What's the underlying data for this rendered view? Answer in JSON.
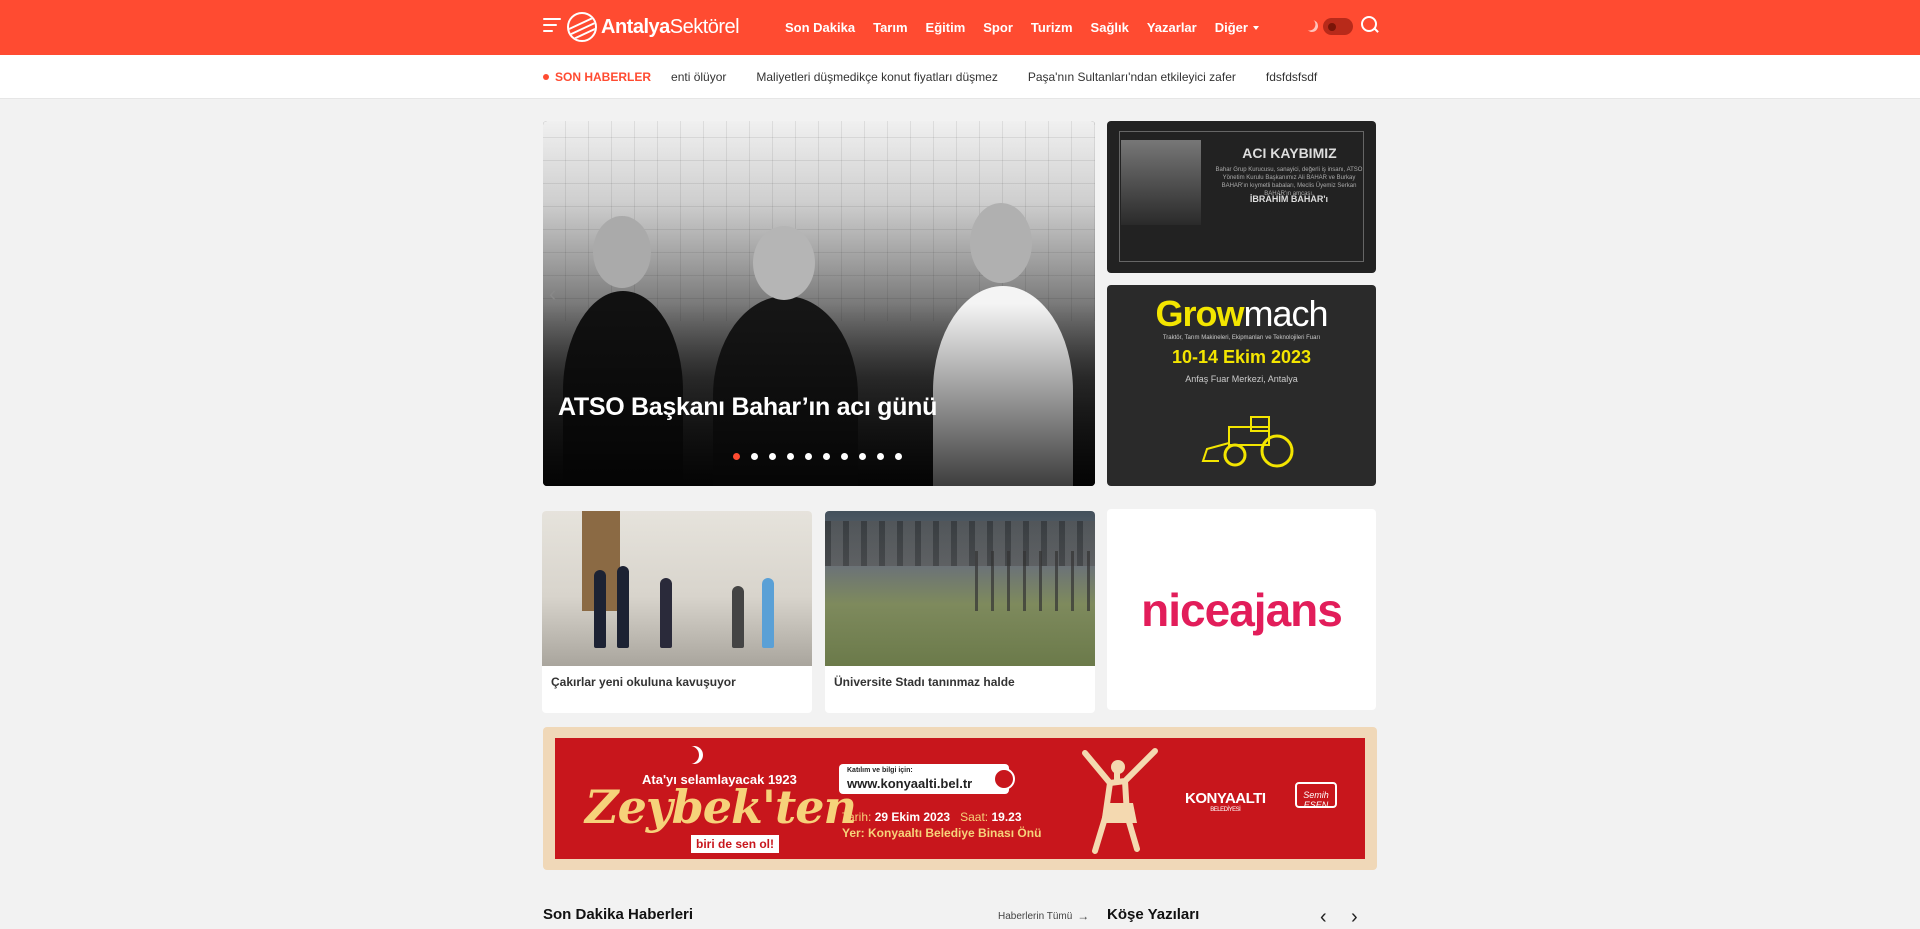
{
  "brand": {
    "name_bold": "Antalya",
    "name_light": "Sektörel",
    "accent": "#ff4b31"
  },
  "nav": [
    "Son Dakika",
    "Tarım",
    "Eğitim",
    "Spor",
    "Turizm",
    "Sağlık",
    "Yazarlar",
    "Diğer"
  ],
  "ticker": {
    "label": "SON HABERLER",
    "items": [
      "enti ölüyor",
      "Maliyetleri düşmedikçe konut fiyatları düşmez",
      "Paşa'nın Sultanları'ndan etkileyici zafer",
      "fdsfdsfsdf"
    ]
  },
  "hero": {
    "title": "ATSO Başkanı Bahar’ın acı günü",
    "prev": "‹",
    "active_dot": 1,
    "dot_count": 10
  },
  "ad_loss": {
    "title": "ACI KAYBIMIZ",
    "text": "Bahar Grup Kurucusu, sanayici, değerli iş insanı, ATSO Yönetim Kurulu Başkanımız Ali BAHAR ve Burkay BAHAR'ın kıymetli babaları, Meclis Üyemiz Serkan BAHAR'ın amcası,",
    "name": "İBRAHİM BAHAR'ı"
  },
  "ad_grow": {
    "brand_a": "Grow",
    "brand_b": "mach",
    "subtitle": "Traktör, Tarım Makineleri, Ekipmanları ve Teknolojileri Fuarı",
    "date": "10-14 Ekim 2023",
    "location": "Anfaş Fuar Merkezi, Antalya"
  },
  "cards": [
    {
      "title": "Çakırlar yeni okuluna kavuşuyor"
    },
    {
      "title": "Üniversite Stadı tanınmaz halde"
    }
  ],
  "ad_nice": {
    "brand": "niceajans"
  },
  "ad_wide": {
    "line1": "Ata'yı selamlayacak 1923",
    "headline": "Zeybek'ten",
    "tagline": "biri de sen ol!",
    "info_label": "Katılım ve bilgi için:",
    "url": "www.konyaalti.bel.tr",
    "date_label": "Tarih:",
    "date_value": "29 Ekim 2023",
    "time_label": "Saat:",
    "time_value": "19.23",
    "place": "Yer: Konyaaltı Belediye Binası Önü",
    "municipality": "KONYAALTI",
    "municipality_sub": "BELEDİYESİ",
    "mayor": "Semih ESEN"
  },
  "sections": {
    "left_title": "Son Dakika Haberleri",
    "left_link": "Haberlerin Tümü",
    "right_title": "Köşe Yazıları",
    "prev": "‹",
    "next": "›"
  }
}
